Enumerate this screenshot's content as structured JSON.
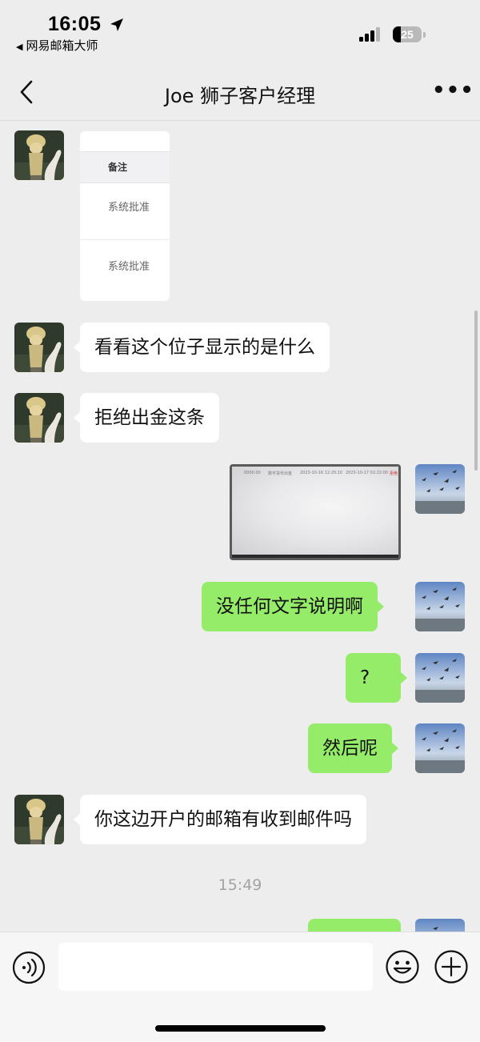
{
  "status_bar": {
    "time": "16:05",
    "back_app_arrow": "◀",
    "back_app": "网易邮箱大师",
    "battery": "25",
    "icons": [
      "location-arrow-icon",
      "signal-icon",
      "battery-icon"
    ]
  },
  "nav": {
    "title": "Joe 狮子客户经理",
    "more": "•••",
    "icons": [
      "back-chevron-icon",
      "more-icon"
    ]
  },
  "card": {
    "header": "备注",
    "rows": [
      "系统批准",
      "系统批准"
    ]
  },
  "screenshot_image": {
    "texts": [
      "0000.00",
      "数字货币出金",
      "2023-10-16 12:20:10",
      "2023-10-17 02:22:00",
      "拒绝"
    ]
  },
  "messages": [
    {
      "from": "contact",
      "text": "看看这个位子显示的是什么"
    },
    {
      "from": "contact",
      "text": "拒绝出金这条"
    },
    {
      "from": "me",
      "text": "没任何文字说明啊"
    },
    {
      "from": "me",
      "text": "?"
    },
    {
      "from": "me",
      "text": "然后呢"
    },
    {
      "from": "contact",
      "text": "你这边开户的邮箱有收到邮件吗"
    }
  ],
  "timestamp": "15:49",
  "input": {
    "placeholder": "",
    "icons": [
      "voice-icon",
      "emoji-icon",
      "plus-icon"
    ]
  },
  "colors": {
    "background": "#ededed",
    "bubble_out": "#95ec69",
    "bubble_in": "#ffffff"
  }
}
